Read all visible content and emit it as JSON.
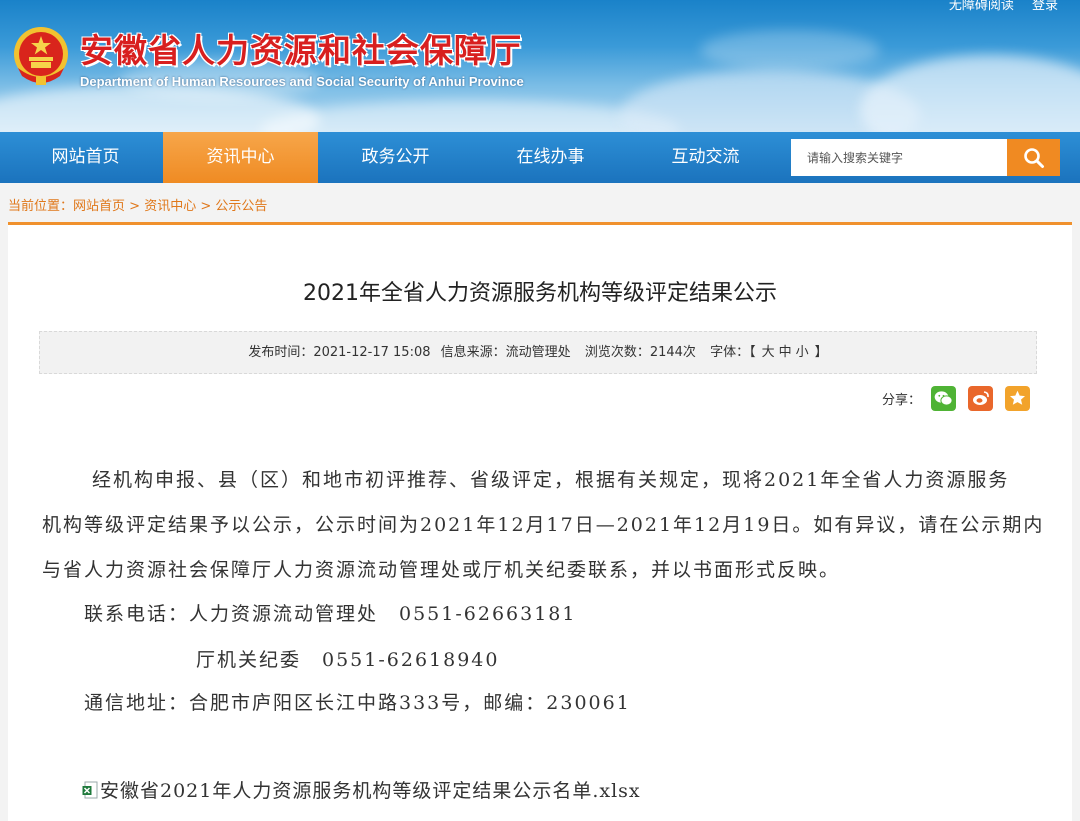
{
  "header": {
    "title_cn": "安徽省人力资源和社会保障厅",
    "title_en": "Department of Human Resources and Social Security of Anhui Province",
    "accessibility_label": "无障碍阅读",
    "login_label": "登录"
  },
  "nav": {
    "items": [
      {
        "label": "网站首页"
      },
      {
        "label": "资讯中心"
      },
      {
        "label": "政务公开"
      },
      {
        "label": "在线办事"
      },
      {
        "label": "互动交流"
      }
    ],
    "search_placeholder": "请输入搜索关键字"
  },
  "breadcrumb": {
    "prefix": "当前位置：",
    "items": [
      "网站首页",
      "资讯中心",
      "公示公告"
    ],
    "separator": " > "
  },
  "article": {
    "title": "2021年全省人力资源服务机构等级评定结果公示",
    "meta": {
      "publish_label": "发布时间：",
      "publish_time": "2021-12-17 15:08",
      "source_label": "信息来源：",
      "source": "流动管理处",
      "views_label": "浏览次数：",
      "views": "2144次",
      "font_label": "字体：",
      "font_open": "【",
      "font_large": "大",
      "font_medium": "中",
      "font_small": "小",
      "font_close": "】"
    },
    "share_label": "分享：",
    "paragraphs": [
      "经机构申报、县（区）和地市初评推荐、省级评定，根据有关规定，现将2021年全省人力资源服务",
      "机构等级评定结果予以公示，公示时间为2021年12月17日—2021年12月19日。如有异议，请在公示期内",
      "与省人力资源社会保障厅人力资源流动管理处或厅机关纪委联系，并以书面形式反映。",
      "联系电话：人力资源流动管理处　0551-62663181",
      "厅机关纪委　0551-62618940",
      "通信地址：合肥市庐阳区长江中路333号，邮编：230061"
    ],
    "attachment": "安徽省2021年人力资源服务机构等级评定结果公示名单.xlsx"
  },
  "colors": {
    "accent_orange": "#f08a22",
    "nav_blue": "#1b73bd",
    "title_red": "#d81f1f",
    "breadcrumb_orange": "#e0781b"
  }
}
